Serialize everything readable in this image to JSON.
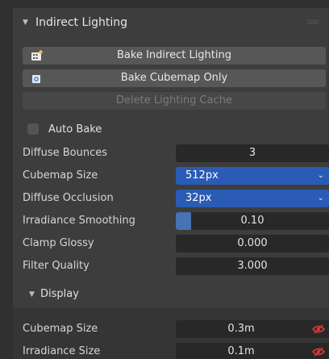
{
  "panel": {
    "title": "Indirect Lighting",
    "buttons": {
      "bake_indirect": "Bake Indirect Lighting",
      "bake_cubemap": "Bake Cubemap Only",
      "delete_cache": "Delete Lighting Cache"
    },
    "auto_bake": {
      "label": "Auto Bake",
      "checked": false
    },
    "properties": [
      {
        "label": "Diffuse Bounces",
        "value": "3"
      },
      {
        "label": "Cubemap Size",
        "value": "512px",
        "type": "dropdown"
      },
      {
        "label": "Diffuse Occlusion",
        "value": "32px",
        "type": "dropdown"
      },
      {
        "label": "Irradiance Smoothing",
        "value": "0.10",
        "fraction": 0.1
      },
      {
        "label": "Clamp Glossy",
        "value": "0.000"
      },
      {
        "label": "Filter Quality",
        "value": "3.000"
      }
    ],
    "display": {
      "title": "Display",
      "properties": [
        {
          "label": "Cubemap Size",
          "value": "0.3m"
        },
        {
          "label": "Irradiance Size",
          "value": "0.1m"
        }
      ]
    }
  },
  "icons": {
    "header_toggle": "triangle-down-icon",
    "bake_indirect": "light-probe-grid-icon",
    "bake_cubemap": "light-probe-cubemap-icon",
    "visibility": "hide-eye-icon"
  },
  "colors": {
    "accent_dropdown": "#2a5bb5",
    "slider_fill": "#4772b3",
    "eye_red": "#d23a3a"
  }
}
